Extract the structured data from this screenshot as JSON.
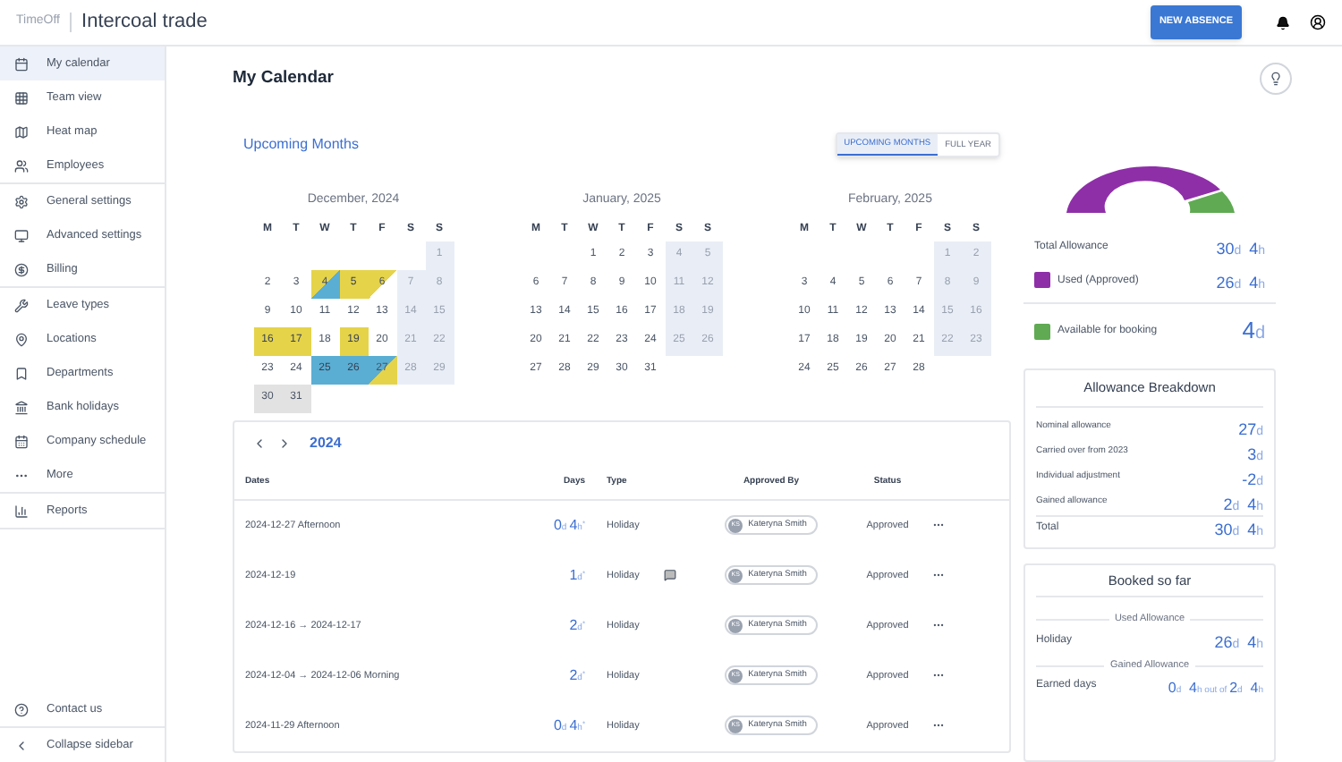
{
  "app": {
    "logo": "TimeOff",
    "company": "Intercoal trade",
    "new_button": "NEW ABSENCE"
  },
  "sidebar": {
    "groups": [
      [
        {
          "label": "My calendar",
          "selected": true
        },
        {
          "label": "Team view",
          "selected": false
        },
        {
          "label": "Heat map",
          "selected": false
        },
        {
          "label": "Employees",
          "selected": false
        }
      ],
      [
        {
          "label": "General settings",
          "selected": false
        },
        {
          "label": "Advanced settings",
          "selected": false
        },
        {
          "label": "Billing",
          "selected": false
        }
      ],
      [
        {
          "label": "Leave types",
          "selected": false
        },
        {
          "label": "Locations",
          "selected": false
        },
        {
          "label": "Departments",
          "selected": false
        },
        {
          "label": "Bank holidays",
          "selected": false
        },
        {
          "label": "Company schedule",
          "selected": false
        },
        {
          "label": "More",
          "selected": false
        }
      ],
      [
        {
          "label": "Reports",
          "selected": false
        }
      ]
    ],
    "footer": [
      {
        "label": "Contact us"
      },
      {
        "label": "Collapse sidebar"
      }
    ]
  },
  "page": {
    "title": "My Calendar",
    "section": "Upcoming Months",
    "views": [
      {
        "label": "UPCOMING MONTHS",
        "selected": true
      },
      {
        "label": "FULL YEAR",
        "selected": false
      }
    ]
  },
  "calendar": {
    "months": [
      {
        "title": "December, 2024",
        "weekdays": [
          "M",
          "T",
          "W",
          "T",
          "F",
          "S",
          "S"
        ],
        "weeks": [
          [
            {
              "day": "1",
              "kind": "weekend"
            }
          ],
          [
            {
              "day": "2",
              "kind": "plain"
            },
            {
              "day": "3",
              "kind": "plain"
            },
            {
              "day": "4",
              "kind": "yellow-blue"
            },
            {
              "day": "5",
              "kind": "yellow"
            },
            {
              "day": "6",
              "kind": "yellow-corner"
            },
            {
              "day": "7",
              "kind": "weekend"
            },
            {
              "day": "8",
              "kind": "weekend"
            }
          ],
          [
            {
              "day": "9",
              "kind": "plain"
            },
            {
              "day": "10",
              "kind": "plain"
            },
            {
              "day": "11",
              "kind": "plain"
            },
            {
              "day": "12",
              "kind": "plain"
            },
            {
              "day": "13",
              "kind": "plain"
            },
            {
              "day": "14",
              "kind": "weekend"
            },
            {
              "day": "15",
              "kind": "weekend"
            }
          ],
          [
            {
              "day": "16",
              "kind": "yellow"
            },
            {
              "day": "17",
              "kind": "yellow"
            },
            {
              "day": "18",
              "kind": "plain"
            },
            {
              "day": "19",
              "kind": "yellow"
            },
            {
              "day": "20",
              "kind": "plain"
            },
            {
              "day": "21",
              "kind": "weekend"
            },
            {
              "day": "22",
              "kind": "weekend"
            }
          ],
          [
            {
              "day": "23",
              "kind": "plain"
            },
            {
              "day": "24",
              "kind": "plain"
            },
            {
              "day": "25",
              "kind": "blue"
            },
            {
              "day": "26",
              "kind": "blue"
            },
            {
              "day": "27",
              "kind": "blue-yellow"
            },
            {
              "day": "28",
              "kind": "weekend"
            },
            {
              "day": "29",
              "kind": "weekend"
            }
          ],
          [
            {
              "day": "30",
              "kind": "grey"
            },
            {
              "day": "31",
              "kind": "grey"
            }
          ]
        ]
      },
      {
        "title": "January, 2025",
        "weekdays": [
          "M",
          "T",
          "W",
          "T",
          "F",
          "S",
          "S"
        ],
        "weeks": [
          [
            {
              "day": "1",
              "kind": "plain"
            },
            {
              "day": "2",
              "kind": "plain"
            },
            {
              "day": "3",
              "kind": "plain"
            },
            {
              "day": "4",
              "kind": "weekend"
            },
            {
              "day": "5",
              "kind": "weekend"
            }
          ],
          [
            {
              "day": "6",
              "kind": "plain"
            },
            {
              "day": "7",
              "kind": "plain"
            },
            {
              "day": "8",
              "kind": "plain"
            },
            {
              "day": "9",
              "kind": "plain"
            },
            {
              "day": "10",
              "kind": "plain"
            },
            {
              "day": "11",
              "kind": "weekend"
            },
            {
              "day": "12",
              "kind": "weekend"
            }
          ],
          [
            {
              "day": "13",
              "kind": "plain"
            },
            {
              "day": "14",
              "kind": "plain"
            },
            {
              "day": "15",
              "kind": "plain"
            },
            {
              "day": "16",
              "kind": "plain"
            },
            {
              "day": "17",
              "kind": "plain"
            },
            {
              "day": "18",
              "kind": "weekend"
            },
            {
              "day": "19",
              "kind": "weekend"
            }
          ],
          [
            {
              "day": "20",
              "kind": "plain"
            },
            {
              "day": "21",
              "kind": "plain"
            },
            {
              "day": "22",
              "kind": "plain"
            },
            {
              "day": "23",
              "kind": "plain"
            },
            {
              "day": "24",
              "kind": "plain"
            },
            {
              "day": "25",
              "kind": "weekend"
            },
            {
              "day": "26",
              "kind": "weekend"
            }
          ],
          [
            {
              "day": "27",
              "kind": "plain"
            },
            {
              "day": "28",
              "kind": "plain"
            },
            {
              "day": "29",
              "kind": "plain"
            },
            {
              "day": "30",
              "kind": "plain"
            },
            {
              "day": "31",
              "kind": "plain"
            }
          ]
        ]
      },
      {
        "title": "February, 2025",
        "weekdays": [
          "M",
          "T",
          "W",
          "T",
          "F",
          "S",
          "S"
        ],
        "weeks": [
          [
            {
              "day": "1",
              "kind": "weekend"
            },
            {
              "day": "2",
              "kind": "weekend"
            }
          ],
          [
            {
              "day": "3",
              "kind": "plain"
            },
            {
              "day": "4",
              "kind": "plain"
            },
            {
              "day": "5",
              "kind": "plain"
            },
            {
              "day": "6",
              "kind": "plain"
            },
            {
              "day": "7",
              "kind": "plain"
            },
            {
              "day": "8",
              "kind": "weekend"
            },
            {
              "day": "9",
              "kind": "weekend"
            }
          ],
          [
            {
              "day": "10",
              "kind": "plain"
            },
            {
              "day": "11",
              "kind": "plain"
            },
            {
              "day": "12",
              "kind": "plain"
            },
            {
              "day": "13",
              "kind": "plain"
            },
            {
              "day": "14",
              "kind": "plain"
            },
            {
              "day": "15",
              "kind": "weekend"
            },
            {
              "day": "16",
              "kind": "weekend"
            }
          ],
          [
            {
              "day": "17",
              "kind": "plain"
            },
            {
              "day": "18",
              "kind": "plain"
            },
            {
              "day": "19",
              "kind": "plain"
            },
            {
              "day": "20",
              "kind": "plain"
            },
            {
              "day": "21",
              "kind": "plain"
            },
            {
              "day": "22",
              "kind": "weekend"
            },
            {
              "day": "23",
              "kind": "weekend"
            }
          ],
          [
            {
              "day": "24",
              "kind": "plain"
            },
            {
              "day": "25",
              "kind": "plain"
            },
            {
              "day": "26",
              "kind": "plain"
            },
            {
              "day": "27",
              "kind": "plain"
            },
            {
              "day": "28",
              "kind": "plain"
            }
          ]
        ]
      }
    ]
  },
  "absences": {
    "year": "2024",
    "columns": [
      "Dates",
      "Days",
      "Type",
      "Approved By",
      "Status"
    ],
    "rows": [
      {
        "dates": "2024-12-27 Afternoon",
        "days": [
          {
            "value": "0",
            "unit": "d"
          },
          {
            "value": "4",
            "unit": "h"
          }
        ],
        "mark": "*",
        "type": "Holiday",
        "comment": false,
        "initials": "KS",
        "approver": "Kateryna Smith",
        "status": "Approved"
      },
      {
        "dates": "2024-12-19",
        "days": [
          {
            "value": "1",
            "unit": "d"
          }
        ],
        "mark": "*",
        "type": "Holiday",
        "comment": true,
        "initials": "KS",
        "approver": "Kateryna Smith",
        "status": "Approved"
      },
      {
        "dates": "2024-12-16 → 2024-12-17",
        "days": [
          {
            "value": "2",
            "unit": "d"
          }
        ],
        "mark": "*",
        "type": "Holiday",
        "comment": false,
        "initials": "KS",
        "approver": "Kateryna Smith",
        "status": "Approved"
      },
      {
        "dates": "2024-12-04 → 2024-12-06 Morning",
        "days": [
          {
            "value": "2",
            "unit": "d"
          }
        ],
        "mark": "*",
        "type": "Holiday",
        "comment": false,
        "initials": "KS",
        "approver": "Kateryna Smith",
        "status": "Approved"
      },
      {
        "dates": "2024-11-29 Afternoon",
        "days": [
          {
            "value": "0",
            "unit": "d"
          },
          {
            "value": "4",
            "unit": "h"
          }
        ],
        "mark": "*",
        "type": "Holiday",
        "comment": false,
        "initials": "KS",
        "approver": "Kateryna Smith",
        "status": "Approved"
      }
    ]
  },
  "allowance": {
    "total": {
      "label": "Total Allowance",
      "amount": [
        {
          "value": "30",
          "unit": "d"
        },
        {
          "value": "4",
          "unit": "h"
        }
      ]
    },
    "legend": [
      {
        "label": "Used (Approved)",
        "color": "#8e2fa8",
        "amount": [
          {
            "value": "26",
            "unit": "d"
          },
          {
            "value": "4",
            "unit": "h"
          }
        ]
      },
      {
        "label": "Available for booking",
        "color": "#5faa52",
        "amount": [
          {
            "value": "4",
            "unit": "d"
          }
        ]
      }
    ]
  },
  "breakdown": {
    "title": "Allowance Breakdown",
    "rows": [
      {
        "label": "Nominal allowance",
        "amount": [
          {
            "value": "27",
            "unit": "d"
          }
        ]
      },
      {
        "label": "Carried over from 2023",
        "amount": [
          {
            "value": "3",
            "unit": "d"
          }
        ]
      },
      {
        "label": "Individual adjustment",
        "amount": [
          {
            "value": "-2",
            "unit": "d"
          }
        ]
      },
      {
        "label": "Gained allowance",
        "amount": [
          {
            "value": "2",
            "unit": "d"
          },
          {
            "value": "4",
            "unit": "h"
          }
        ]
      }
    ],
    "total": {
      "label": "Total",
      "amount": [
        {
          "value": "30",
          "unit": "d"
        },
        {
          "value": "4",
          "unit": "h"
        }
      ]
    }
  },
  "booked": {
    "title": "Booked so far",
    "used_heading": "Used Allowance",
    "used": [
      {
        "label": "Holiday",
        "amount": [
          {
            "value": "26",
            "unit": "d"
          },
          {
            "value": "4",
            "unit": "h"
          }
        ]
      }
    ],
    "gained_heading": "Gained Allowance",
    "gained": [
      {
        "label": "Earned days",
        "amount": [
          {
            "value": "0",
            "unit": "d"
          },
          {
            "value": "4",
            "unit": "h"
          }
        ],
        "connector": "out of",
        "of": [
          {
            "value": "2",
            "unit": "d"
          },
          {
            "value": "4",
            "unit": "h"
          }
        ]
      }
    ]
  }
}
